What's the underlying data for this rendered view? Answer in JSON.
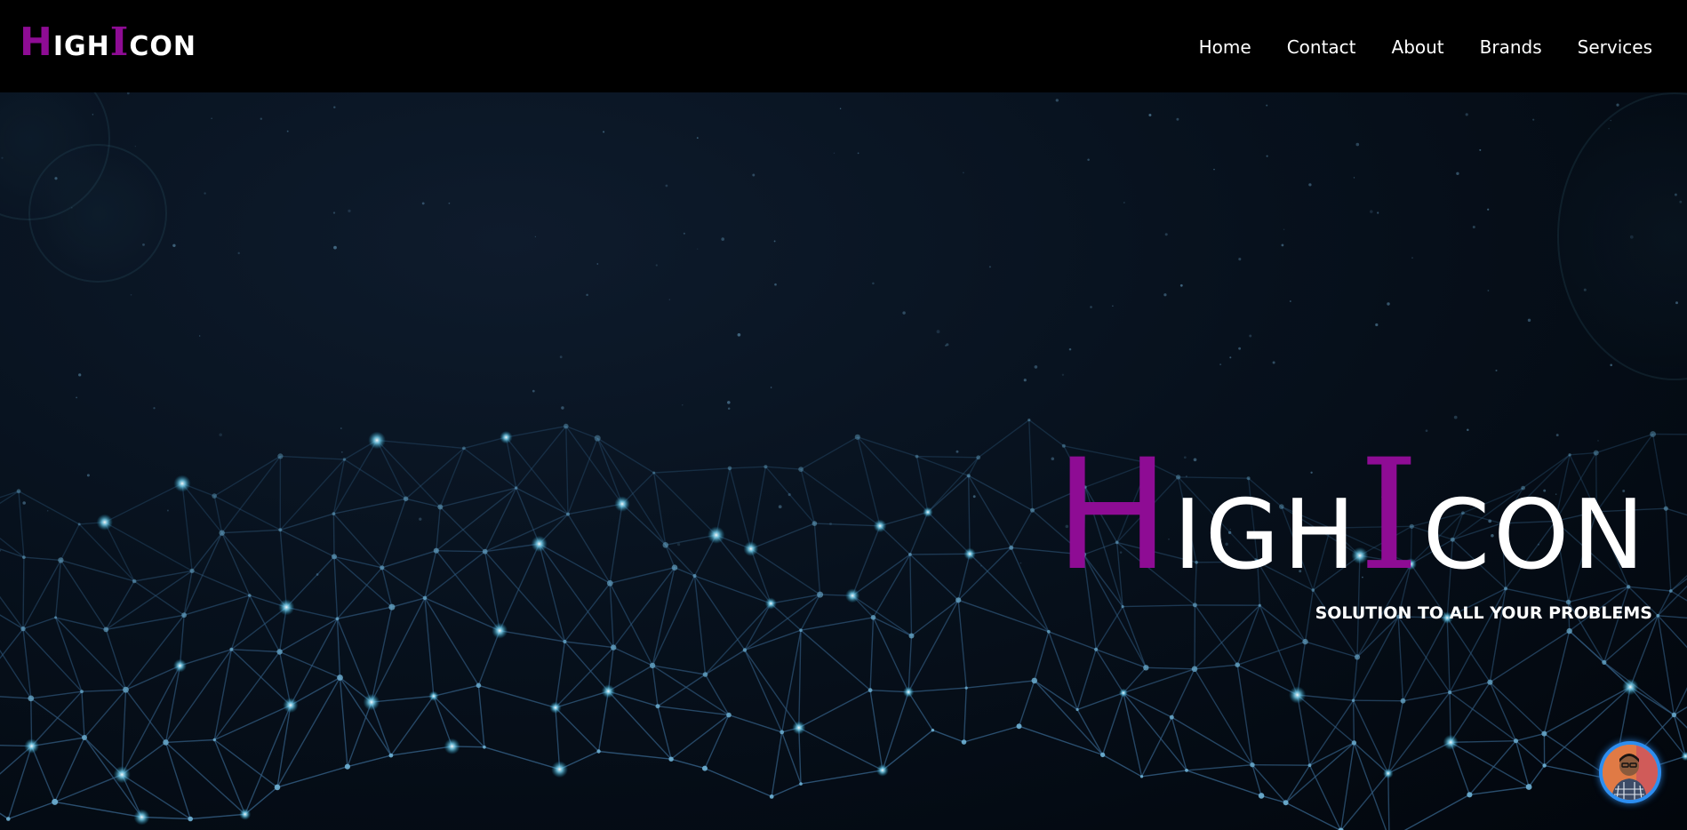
{
  "header": {
    "logo": {
      "cap_h": "H",
      "rest_1": "IGH",
      "cap_i": "I",
      "rest_2": "CON"
    },
    "nav": [
      {
        "label": "Home"
      },
      {
        "label": "Contact"
      },
      {
        "label": "About"
      },
      {
        "label": "Brands"
      },
      {
        "label": "Services"
      }
    ]
  },
  "hero": {
    "title": {
      "cap_h": "H",
      "rest_1": "IGH",
      "cap_i": "I",
      "rest_2": "CON"
    },
    "tagline": "SOLUTION TO ALL YOUR PROBLEMS"
  },
  "colors": {
    "brand": "#8e0c94",
    "background": "#000000",
    "hero_dark": "#07111d",
    "network_line": "#3d6f9a",
    "avatar_ring": "#2d8ef0"
  },
  "icons": {
    "avatar": "profile-avatar"
  }
}
